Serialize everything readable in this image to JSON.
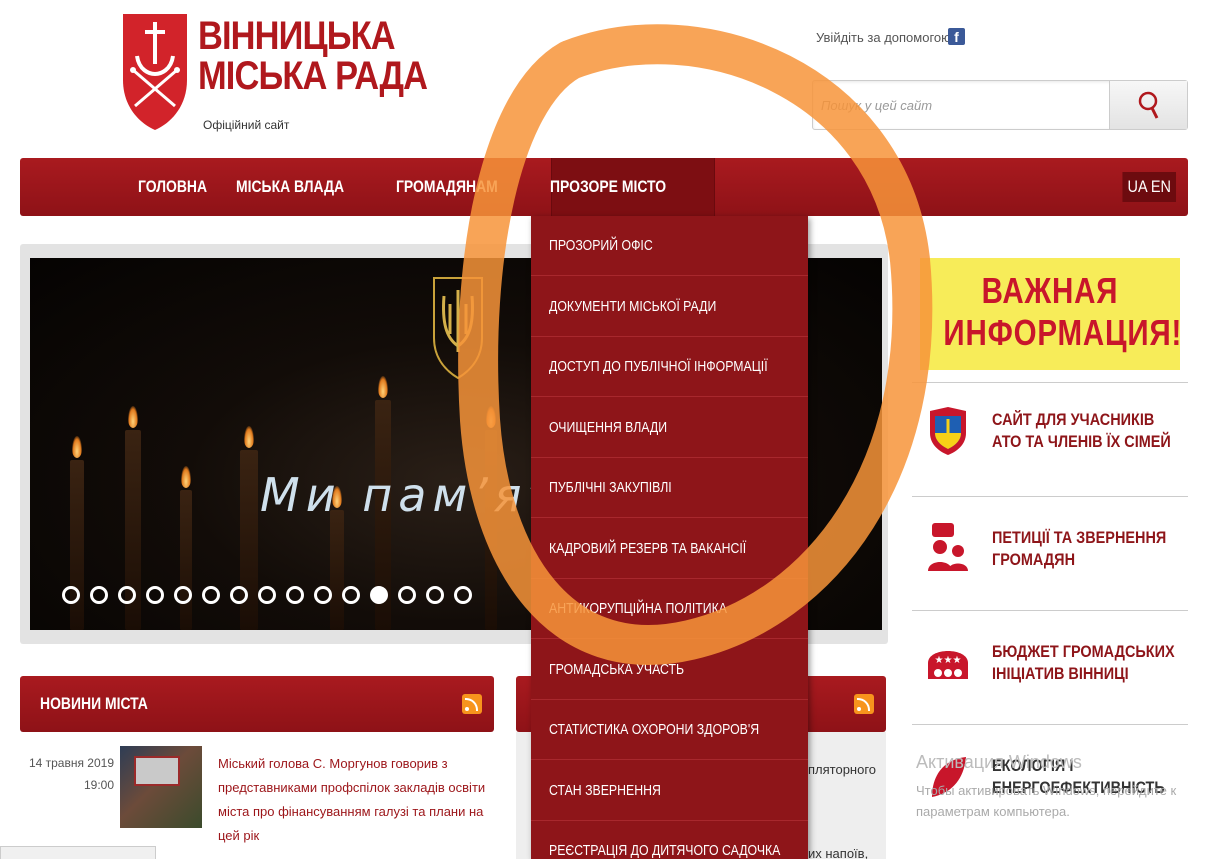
{
  "header": {
    "logo_title_line1": "ВІННИЦЬКА",
    "logo_title_line2": "МІСЬКА РАДА",
    "logo_subtitle": "Офіційний сайт",
    "login_text": "Увійдіть за допомогою",
    "fb_letter": "f",
    "search_placeholder": "Пошук у цей сайт"
  },
  "nav": {
    "items": [
      {
        "label": "ГОЛОВНА"
      },
      {
        "label": "МІСЬКА ВЛАДА"
      },
      {
        "label": "ГРОМАДЯНАМ"
      },
      {
        "label": "ПРОЗОРЕ МІСТО"
      }
    ],
    "lang": "UA EN"
  },
  "dropdown": {
    "items": [
      "ПРОЗОРИЙ ОФІС",
      "ДОКУМЕНТИ МІСЬКОЇ РАДИ",
      "ДОСТУП ДО ПУБЛІЧНОЇ ІНФОРМАЦІЇ",
      "ОЧИЩЕННЯ ВЛАДИ",
      "ПУБЛІЧНІ ЗАКУПІВЛІ",
      "КАДРОВИЙ РЕЗЕРВ ТА ВАКАНСІЇ",
      "АНТИКОРУПЦІЙНА ПОЛІТИКА",
      "ГРОМАДСЬКА УЧАСТЬ",
      "СТАТИСТИКА ОХОРОНИ ЗДОРОВ'Я",
      "СТАН ЗВЕРНЕННЯ",
      "РЕЄСТРАЦІЯ ДО ДИТЯЧОГО САДОЧКА"
    ]
  },
  "slider": {
    "caption": "Ми пам’ят",
    "dot_count": 15,
    "active_dot": 11
  },
  "right": {
    "banner_line1": "ВАЖНАЯ",
    "banner_line2": "ИНФОРМАЦИЯ!",
    "items": [
      {
        "line1": "САЙТ ДЛЯ УЧАСНИКІВ",
        "line2": "АТО ТА ЧЛЕНІВ ЇХ СІМЕЙ"
      },
      {
        "line1": "ПЕТИЦІЇ ТА ЗВЕРНЕННЯ",
        "line2": "ГРОМАДЯН"
      },
      {
        "line1": "БЮДЖЕТ ГРОМАДСЬКИХ",
        "line2": "ІНІЦІАТИВ ВІННИЦІ"
      },
      {
        "line1": "ЕКОЛОГІЯ І",
        "line2": "ЕНЕРГОЕФЕКТИВНІСТЬ"
      }
    ],
    "watermark_title": "Активация Windows",
    "watermark_text": "Чтобы активировать Windows, перейдите к параметрам компьютера."
  },
  "news": {
    "title": "НОВИНИ МІСТА",
    "date": "14 травня 2019",
    "time": "19:00",
    "headline": "Міський голова С. Моргунов говорив з представниками профспілок закладів освіти міста про фінансуванням галузі та плани на цей рік",
    "snippet1": "пляторного",
    "snippet2": "их напоїв,"
  },
  "colors": {
    "brand_red": "#9c1519",
    "dropdown_bg": "#8e1519",
    "banner_yellow": "#f7ec59",
    "annotation_orange": "#f7943a"
  }
}
